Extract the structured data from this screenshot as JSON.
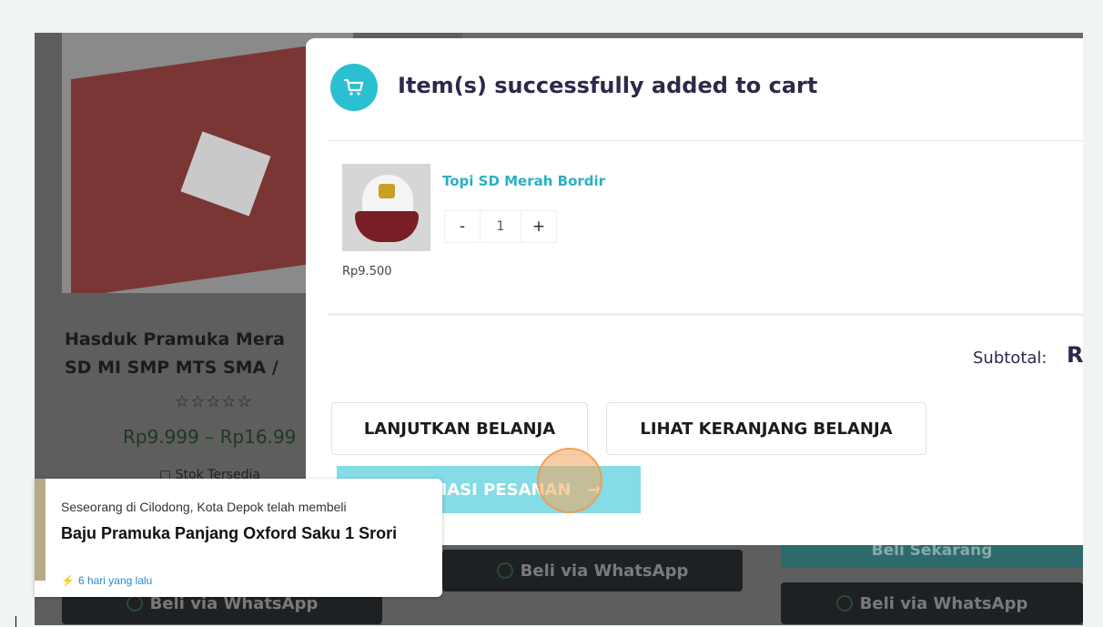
{
  "background_page": {
    "product_title": "Hasduk Pramuka Mera\nSD MI SMP MTS SMA /",
    "rating_stars": "☆☆☆☆☆",
    "price_range": "Rp9.999 – Rp16.99",
    "stock_text": "▢ Stok Tersedia",
    "whatsapp_buttons": [
      "Beli via WhatsApp",
      "Beli via WhatsApp",
      "Beli via WhatsApp"
    ],
    "buy_now_label": "Beli Sekarang"
  },
  "modal": {
    "title": "Item(s) successfully added to cart",
    "item": {
      "name": "Topi SD Merah Bordir",
      "qty_minus": "-",
      "quantity": "1",
      "qty_plus": "+",
      "price": "Rp9.500"
    },
    "subtotal_label": "Subtotal:",
    "subtotal_value": "R",
    "continue_button": "LANJUTKAN BELANJA",
    "view_cart_button": "LIHAT KERANJANG BELANJA",
    "checkout_button": "KONFIRMASI PESANAN",
    "checkout_visible": "MASI PESANAN",
    "checkout_arrow": "→"
  },
  "notification": {
    "subtitle": "Seseorang di Cilodong, Kota Depok telah membeli",
    "product": "Baju Pramuka Panjang Oxford Saku 1 Srori",
    "time": "6 hari yang lalu"
  },
  "colors": {
    "accent_teal": "#2ac0d2",
    "checkout_bg": "#85dbe6",
    "title_navy": "#2c2a4a",
    "time_blue": "#2a8ad0"
  }
}
